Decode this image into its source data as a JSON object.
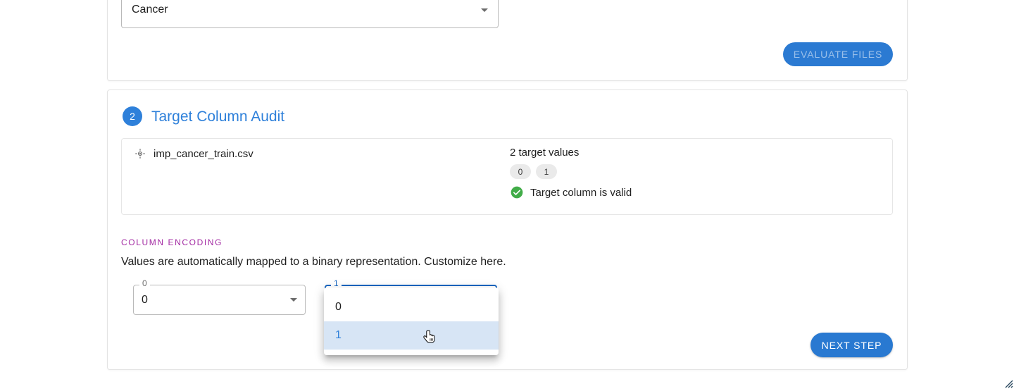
{
  "step1": {
    "target_select": {
      "value": "Cancer",
      "icon": "chevron-down-icon"
    },
    "evaluate_button": "EVALUATE FILES"
  },
  "step2": {
    "badge": "2",
    "title": "Target Column Audit",
    "audit": {
      "file_icon": "crosshair-icon",
      "file_name": "imp_cancer_train.csv",
      "target_count_text": "2 target values",
      "target_values": [
        "0",
        "1"
      ],
      "status_icon": "check-circle-icon",
      "status_text": "Target column is valid"
    },
    "encoding": {
      "section_label": "COLUMN ENCODING",
      "description": "Values are automatically mapped to a binary representation. Customize here.",
      "selects": [
        {
          "label": "0",
          "value": "0",
          "focused": false
        },
        {
          "label": "1",
          "value": "1",
          "focused": true
        }
      ],
      "open_menu": {
        "options": [
          {
            "label": "0",
            "selected": false
          },
          {
            "label": "1",
            "selected": true
          }
        ]
      }
    },
    "next_button": "NEXT STEP"
  },
  "colors": {
    "primary_blue": "#2979d1",
    "title_blue": "#2e80da",
    "focus_blue": "#1565c0",
    "encoding_purple": "#a32ba3",
    "valid_green": "#41ac48",
    "menu_selected_bg": "#d7e5f5",
    "chip_bg": "#eaeaea"
  },
  "cursor": {
    "type": "pointer-hand-cursor"
  }
}
